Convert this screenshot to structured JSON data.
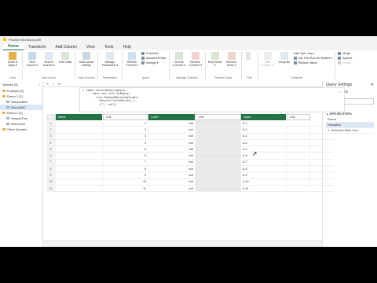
{
  "window": {
    "title": "Practice Workbook.pbit"
  },
  "tabs": [
    "Home",
    "Transform",
    "Add Column",
    "View",
    "Tools",
    "Help"
  ],
  "ribbon": {
    "groups": [
      {
        "name": "Close",
        "buttons": [
          "Close & Apply ▾"
        ]
      },
      {
        "name": "New Query",
        "buttons": [
          "New Source ▾",
          "Recent Sources ▾",
          "Enter Data"
        ]
      },
      {
        "name": "Data Sources",
        "buttons": [
          "Data source settings"
        ]
      },
      {
        "name": "Parameters",
        "buttons": [
          "Manage Parameters ▾"
        ]
      },
      {
        "name": "Query",
        "buttons": [
          "Refresh Preview ▾"
        ],
        "list": [
          "Properties",
          "Advanced Editor",
          "Manage ▾"
        ]
      },
      {
        "name": "Manage Columns",
        "buttons": [
          "Choose Columns ▾",
          "Remove Columns ▾"
        ]
      },
      {
        "name": "Reduce Rows",
        "buttons": [
          "Keep Rows ▾",
          "Remove Rows ▾"
        ]
      },
      {
        "name": "Sort",
        "buttons": []
      },
      {
        "name": "Transform",
        "buttons": [
          "Split Column ▾",
          "Group By"
        ],
        "list": [
          "Data Type: Any ▾",
          "Use First Row as Headers ▾",
          "Replace Values"
        ]
      },
      {
        "name": "",
        "list": [
          "Merge",
          "Append",
          "Combi"
        ]
      }
    ]
  },
  "queries": {
    "header": "Queries [5]",
    "items": [
      {
        "label": "Example [1]",
        "level": 0
      },
      {
        "label": "Demo 1 [2]",
        "level": 0
      },
      {
        "label": "SampleABC",
        "level": 1
      },
      {
        "label": "DemoABC",
        "level": 1,
        "selected": true
      },
      {
        "label": "Demo 2 [2]",
        "level": 0
      },
      {
        "label": "SampleTom",
        "level": 1
      },
      {
        "label": "DemoTom",
        "level": 1
      },
      {
        "label": "Other Queries",
        "level": 0
      }
    ]
  },
  "formula": {
    "code_lines": [
      "= Table.SelectRows(Sample,",
      "      each not List.IsEmpty(",
      "        List.RemoveMatchingItems(",
      "          Record.FieldValues(_),",
      "          {\"\", null}"
    ]
  },
  "grid": {
    "columns": [
      "Name",
      "Lower",
      "Upper"
    ],
    "subcolumns": [
      "Unit",
      "Unit",
      "Unit"
    ],
    "rows": [
      [
        "1",
        "null",
        "A-1"
      ],
      [
        "2",
        "null",
        "A-2"
      ],
      [
        "3",
        "null",
        "A-3"
      ],
      [
        "4",
        "null",
        "A-4"
      ],
      [
        "5",
        "null",
        "A-5"
      ],
      [
        "6",
        "null",
        "A-6"
      ],
      [
        "7",
        "null",
        "A-7"
      ],
      [
        "8",
        "null",
        "A-8"
      ],
      [
        "9",
        "null",
        "A-9"
      ],
      [
        "10",
        "null",
        "A-10"
      ],
      [
        "11",
        "null",
        "A-11"
      ]
    ]
  },
  "settings": {
    "title": "Query Settings",
    "properties_label": "▲ PROPERTIES",
    "name_label": "Name",
    "name_value": "DemoABC",
    "all_properties": "All Properties",
    "applied_label": "▲ APPLIED STEPS",
    "steps": [
      "Source",
      "Navigation",
      "Removed Other Colu..."
    ]
  },
  "status": {
    "text": ""
  }
}
